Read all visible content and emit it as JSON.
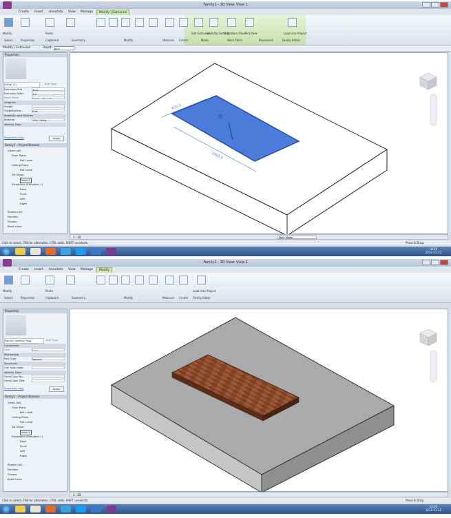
{
  "shots": [
    {
      "title": "Family1 - 3D View: View 1",
      "tabs": [
        "Create",
        "Insert",
        "Annotate",
        "View",
        "Manage",
        "Modify | Extrusion"
      ],
      "active_tab": "Modify | Extrusion",
      "ribbon_groups": [
        "Select",
        "Properties",
        "Clipboard",
        "Geometry",
        "Modify",
        "Measure",
        "Create",
        "Mode",
        "Work Plane",
        "Placement",
        "Family Editor"
      ],
      "ribbon_labels": [
        "Modify",
        "Paste",
        "Edit Extrusion",
        "Visibility Settings",
        "Edit Work Plane",
        "Pick New",
        "Load into Project"
      ],
      "optbar": {
        "label": "Modify | Extrusion",
        "depth_label": "Depth",
        "depth_value": "40.0"
      },
      "properties": {
        "header": "Properties",
        "type_selector": "Other (1)",
        "edit_type": "Edit Type",
        "rows": [
          {
            "k": "Extrusion End",
            "v": "40.0"
          },
          {
            "k": "Extrusion Start",
            "v": "0.0"
          },
          {
            "k": "Work Plane",
            "v": "Level : Ref. Lev"
          },
          {
            "k": "Graphics",
            "v": ""
          },
          {
            "k": "Visible",
            "v": ""
          },
          {
            "k": "Visibility/Gra...",
            "v": "Edit..."
          },
          {
            "k": "Materials and Finishes",
            "v": ""
          },
          {
            "k": "Material",
            "v": "<By Categ..."
          },
          {
            "k": "Identity Data",
            "v": ""
          }
        ],
        "help": "Properties help",
        "apply": "Apply"
      },
      "browser": {
        "header": "Family1 - Project Browser",
        "items": [
          "Views (all)",
          "Floor Plans",
          "Ref. Level",
          "Ceiling Plans",
          "Ref. Level",
          "3D Views",
          "View 1",
          "Elevations (Elevation 1)",
          "Back",
          "Front",
          "Left",
          "Right",
          "Sheets (all)",
          "Families",
          "Groups",
          "Revit Links"
        ]
      },
      "dims": [
        "610.2",
        "1003.9"
      ],
      "scale": "1 : 20",
      "workset": "Main Model",
      "status": "Click to select, TAB for alternates, CTRL adds, SHIFT unselects.",
      "press_drag": "Press & Drag",
      "clock_time": "10:26",
      "clock_date": "2012-11-12"
    },
    {
      "title": "Family1 - 3D View: View 1",
      "tabs": [
        "Create",
        "Insert",
        "Annotate",
        "View",
        "Manage",
        "Modify"
      ],
      "active_tab": "Modify",
      "ribbon_groups": [
        "Select",
        "Properties",
        "Clipboard",
        "Geometry",
        "Modify",
        "Measure",
        "Create",
        "Family Editor"
      ],
      "ribbon_labels": [
        "Modify",
        "Paste",
        "Load into Project"
      ],
      "properties": {
        "header": "Properties",
        "type_selector": "Family: Generic Mod",
        "edit_type": "Edit Type",
        "rows": [
          {
            "k": "Constraints",
            "v": ""
          },
          {
            "k": "Host",
            "v": "Face"
          },
          {
            "k": "Mechanical",
            "v": ""
          },
          {
            "k": "Part Type",
            "v": "Normal"
          },
          {
            "k": "Structural",
            "v": ""
          },
          {
            "k": "Can host rebar",
            "v": ""
          },
          {
            "k": "Identity Data",
            "v": ""
          },
          {
            "k": "OmniClass Nu...",
            "v": ""
          },
          {
            "k": "OmniClass Title",
            "v": ""
          }
        ],
        "help": "Properties help",
        "apply": "Apply"
      },
      "browser": {
        "header": "Family1 - Project Browser",
        "items": [
          "Views (all)",
          "Floor Plans",
          "Ref. Level",
          "Ceiling Plans",
          "Ref. Level",
          "3D Views",
          "View 1",
          "Elevations (Elevation 1)",
          "Back",
          "Front",
          "Left",
          "Right",
          "Sheets (all)",
          "Families",
          "Groups",
          "Revit Links"
        ]
      },
      "scale": "1 : 20",
      "status": "Click to select, TAB for alternates, CTRL adds, SHIFT unselects.",
      "press_drag": "Press & Drag",
      "clock_time": "10:26",
      "clock_date": "2012-11-12"
    }
  ],
  "colors": {
    "selection_blue": "#4d7bdc",
    "wood": "#8b4a2b",
    "slab_gray": "#a9aaab",
    "ribbon_context": "#cfe8b6"
  }
}
